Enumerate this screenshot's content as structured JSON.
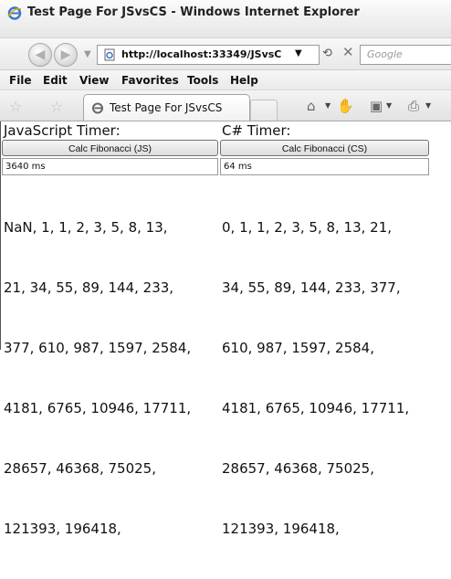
{
  "window": {
    "title": "Test Page For JSvsCS - Windows Internet Explorer"
  },
  "navigation": {
    "back_icon": "back-arrow-icon",
    "forward_icon": "forward-arrow-icon",
    "address": "http://localhost:33349/JSvsC",
    "search_placeholder": "Google"
  },
  "menu": {
    "items": [
      "File",
      "Edit",
      "View",
      "Favorites",
      "Tools",
      "Help"
    ]
  },
  "tab": {
    "label": "Test Page For JSvsCS"
  },
  "page": {
    "js": {
      "heading": "JavaScript Timer:",
      "button_label": "Calc Fibonacci (JS)",
      "time": "3640 ms",
      "lines": [
        "NaN, 1, 1, 2, 3, 5, 8, 13,",
        "21, 34, 55, 89, 144, 233,",
        "377, 610, 987, 1597, 2584,",
        "4181, 6765, 10946, 17711,",
        "28657, 46368, 75025,",
        "121393, 196418,"
      ]
    },
    "cs": {
      "heading": "C# Timer:",
      "button_label": "Calc Fibonacci (CS)",
      "time": "64 ms",
      "lines": [
        "0, 1, 1, 2, 3, 5, 8, 13, 21,",
        "34, 55, 89, 144, 233, 377,",
        "610, 987, 1597, 2584,",
        "4181, 6765, 10946, 17711,",
        "28657, 46368, 75025,",
        "121393, 196418,"
      ]
    }
  }
}
